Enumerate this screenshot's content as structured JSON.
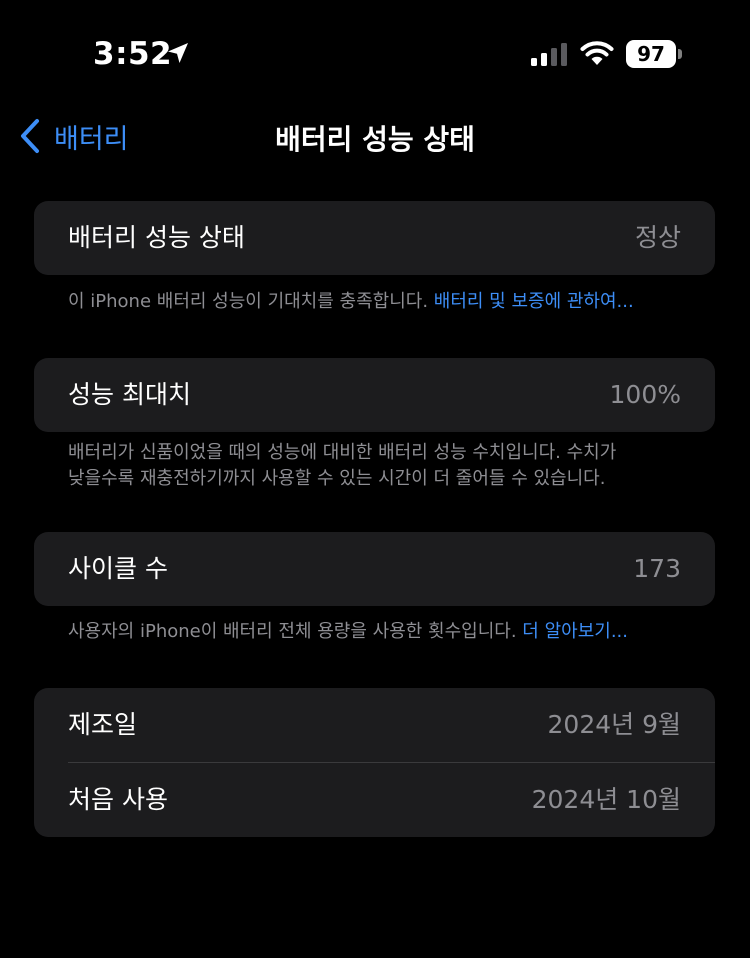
{
  "status_bar": {
    "time": "3:52",
    "battery_level": "97",
    "icons": [
      "location-arrow-icon",
      "cellular-signal-icon",
      "wifi-icon",
      "battery-icon"
    ]
  },
  "nav": {
    "back_label": "배터리",
    "title": "배터리 성능 상태"
  },
  "health": {
    "label": "배터리 성능 상태",
    "value": "정상"
  },
  "health_note": {
    "text": "이 iPhone 배터리 성능이 기대치를 충족합니다. ",
    "link": "배터리 및 보증에 관하여..."
  },
  "capacity": {
    "label": "성능 최대치",
    "value": "100%"
  },
  "capacity_note": {
    "line1": "배터리가 신품이었을 때의 성능에 대비한 배터리 성능 수치입니다. 수치가",
    "line2": "낮을수록 재충전하기까지 사용할 수 있는 시간이 더 줄어들 수 있습니다."
  },
  "cycle": {
    "label": "사이클 수",
    "value": "173"
  },
  "cycle_note": {
    "text": "사용자의 iPhone이 배터리 전체 용량을 사용한 횟수입니다. ",
    "link": "더 알아보기..."
  },
  "manufacture": {
    "label": "제조일",
    "value": "2024년 9월"
  },
  "first_use": {
    "label": "처음 사용",
    "value": "2024년 10월"
  },
  "colors": {
    "background": "#000000",
    "card": "#1c1c1e",
    "accent": "#3d8ef7",
    "secondary_text": "#8e8e93"
  }
}
